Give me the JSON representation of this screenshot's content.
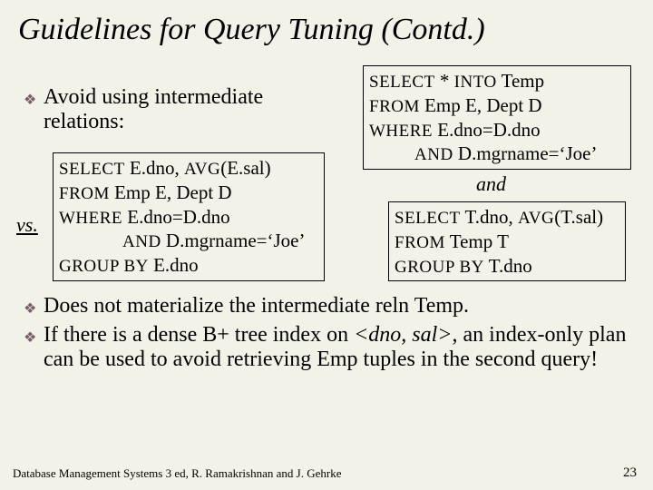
{
  "title": "Guidelines for Query Tuning (Contd.)",
  "bullets": {
    "b1": "Avoid using intermediate relations:",
    "b2": "Does not materialize the intermediate reln Temp.",
    "b3_pre": "If there is a dense B+ tree index on ",
    "b3_em": "<dno, sal>",
    "b3_post": ", an index-only plan can be used to avoid retrieving Emp tuples in the second query!"
  },
  "vs_label": "vs.",
  "and_label": "and",
  "sql_left": {
    "l1a": "SELECT",
    "l1b": "  E.dno, ",
    "l1c": "AVG",
    "l1d": "(E.sal)",
    "l2a": "FROM",
    "l2b": "  Emp E, Dept D",
    "l3a": "WHERE",
    "l3b": "  E.dno=D.dno",
    "l4a": "AND",
    "l4b": "  D.mgrname=‘Joe’",
    "l5a": "GROUP BY",
    "l5b": "  E.dno"
  },
  "sql_top_right": {
    "l1a": "SELECT",
    "l1b": "  *  ",
    "l1c": "INTO",
    "l1d": "  Temp",
    "l2a": "FROM",
    "l2b": "  Emp E, Dept D",
    "l3a": "WHERE",
    "l3b": "  E.dno=D.dno",
    "l4a": "AND",
    "l4b": "  D.mgrname=‘Joe’"
  },
  "sql_bot_right": {
    "l1a": "SELECT",
    "l1b": "  T.dno, ",
    "l1c": "AVG",
    "l1d": "(T.sal)",
    "l2a": "FROM",
    "l2b": "  Temp T",
    "l3a": "GROUP BY",
    "l3b": "  T.dno"
  },
  "footer": {
    "left": "Database Management Systems 3 ed,  R. Ramakrishnan and J. Gehrke",
    "right": "23"
  }
}
